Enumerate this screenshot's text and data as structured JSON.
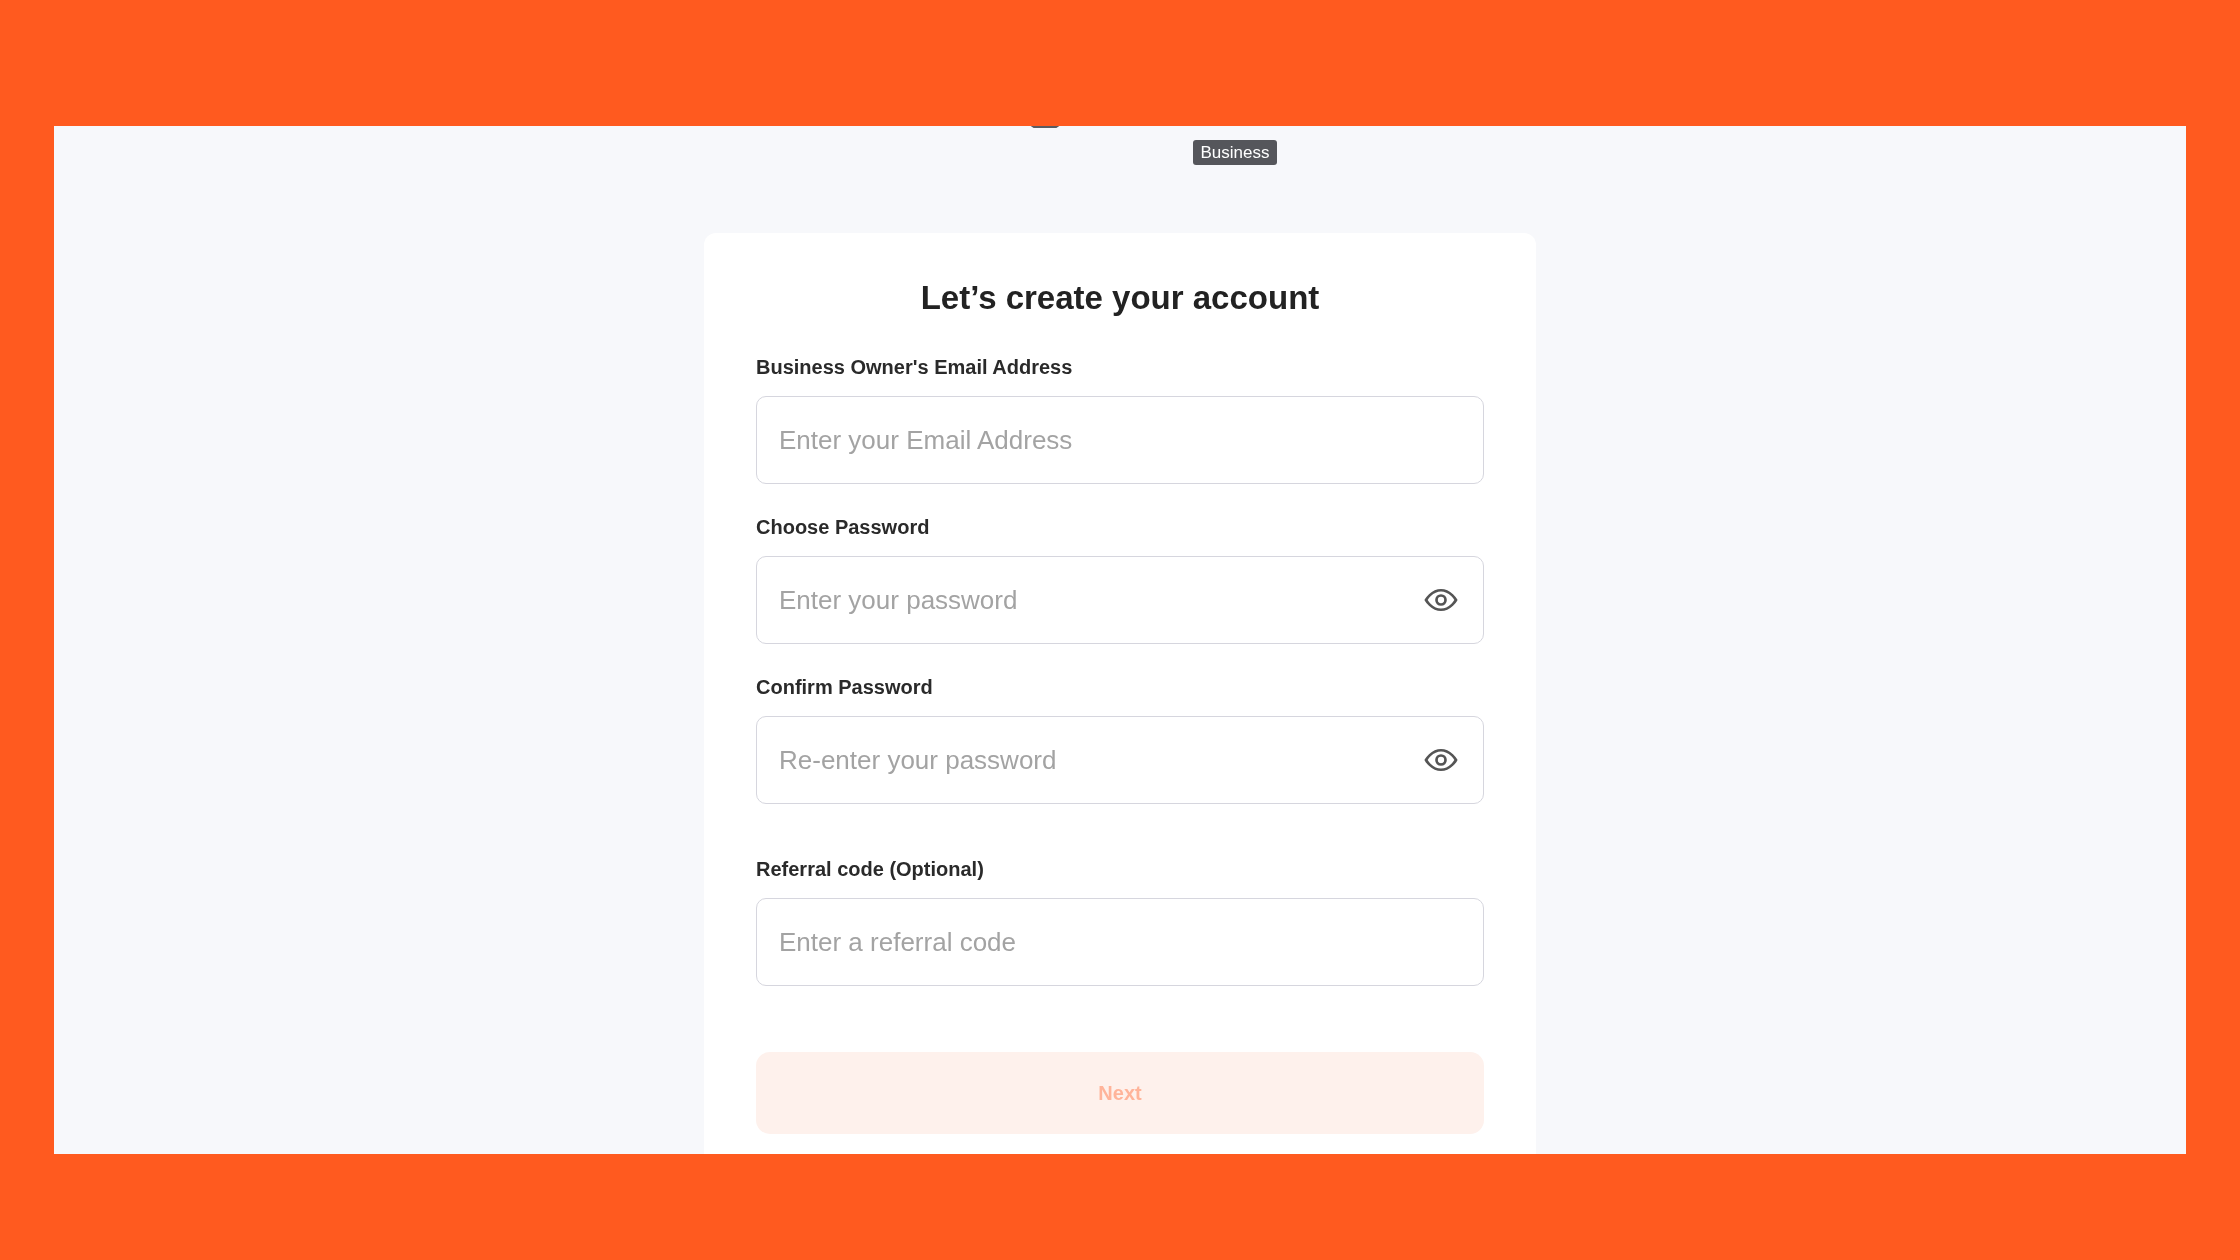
{
  "header": {
    "badge": "Business"
  },
  "form": {
    "title": "Let’s create your account",
    "fields": [
      {
        "kind": "text",
        "label": "Business Owner's Email Address",
        "placeholder": "Enter your Email Address"
      },
      {
        "kind": "password",
        "label": "Choose Password",
        "placeholder": "Enter your password"
      },
      {
        "kind": "password",
        "label": "Confirm Password",
        "placeholder": "Re-enter your password"
      },
      {
        "kind": "text",
        "label": "Referral code (Optional)",
        "placeholder": "Enter a referral code"
      }
    ],
    "submit": {
      "label": "Next",
      "disabled": true
    }
  }
}
